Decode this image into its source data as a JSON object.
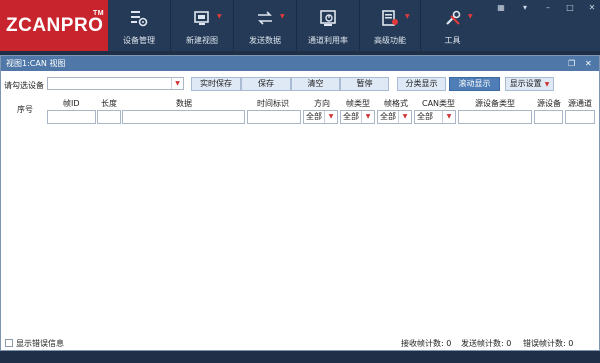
{
  "app": {
    "logo_text": "ZCANPRO",
    "logo_tm": "TM",
    "brand_color": "#c8242d",
    "ribbon_color": "#243a56"
  },
  "ribbon": {
    "tools": [
      {
        "label": "设备管理",
        "icon": "device-manage-icon",
        "dropdown": false
      },
      {
        "label": "新建视图",
        "icon": "new-view-icon",
        "dropdown": true
      },
      {
        "label": "发送数据",
        "icon": "send-data-icon",
        "dropdown": true
      },
      {
        "label": "通道利用率",
        "icon": "channel-usage-icon",
        "dropdown": false
      },
      {
        "label": "高级功能",
        "icon": "advanced-icon",
        "dropdown": true
      },
      {
        "label": "工具",
        "icon": "tools-icon",
        "dropdown": true
      }
    ]
  },
  "view": {
    "title": "视图1:CAN 视图",
    "device_label": "请勾选设备",
    "device_value": "",
    "buttons": {
      "realtime_save": "实时保存",
      "save": "保存",
      "clear": "清空",
      "pause": "暂停",
      "category_display": "分类显示",
      "scroll_display": "滚动显示",
      "display_settings": "显示设置"
    },
    "columns": {
      "index": "序号",
      "frame_id": "帧ID",
      "length": "长度",
      "data": "数据",
      "timestamp": "时间标识",
      "direction": "方向",
      "frame_type": "帧类型",
      "frame_format": "帧格式",
      "can_type": "CAN类型",
      "source_device_type": "源设备类型",
      "source_device": "源设备",
      "source_channel": "源通道"
    },
    "filters": {
      "direction": "全部",
      "frame_type": "全部",
      "frame_format": "全部",
      "can_type": "全部"
    }
  },
  "status": {
    "show_error_info": "显示错误信息",
    "show_error_checked": false,
    "recv_count": "接收帧计数: 0",
    "send_count": "发送帧计数: 0",
    "error_count": "错误帧计数: 0"
  }
}
